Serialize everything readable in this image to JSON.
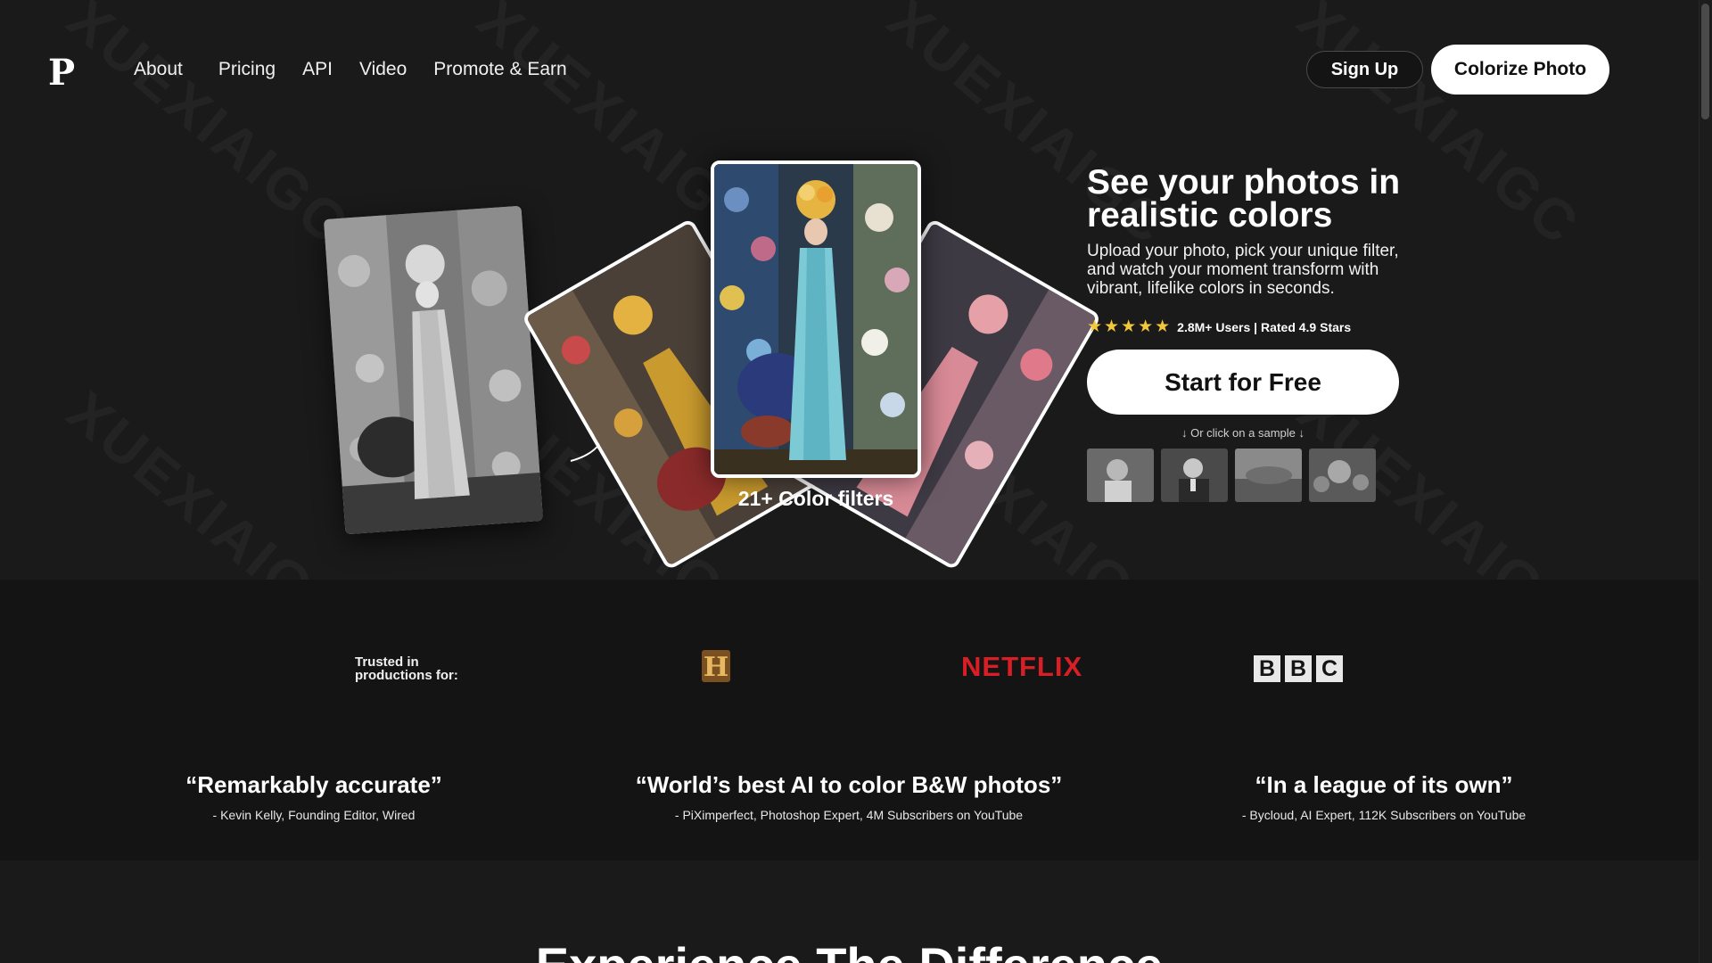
{
  "brand": {
    "logo_letter": "P"
  },
  "nav": {
    "items": [
      "About",
      "Pricing",
      "API",
      "Video",
      "Promote & Earn"
    ]
  },
  "header": {
    "signup_label": "Sign Up",
    "colorize_label": "Colorize Photo"
  },
  "hero": {
    "title": "See your photos in realistic colors",
    "description": "Upload your photo, pick your unique filter, and watch your moment transform with vibrant, lifelike colors in seconds.",
    "stars": "★★★★★",
    "rating_text": "2.8M+ Users | Rated 4.9 Stars",
    "cta_label": "Start for Free",
    "sample_hint": "↓ Or click on a sample ↓",
    "filters_label": "21+ Color filters"
  },
  "trusted": {
    "label_line1": "Trusted in",
    "label_line2": "productions for:",
    "history_letter": "H",
    "netflix": "NETFLIX",
    "bbc": [
      "B",
      "B",
      "C"
    ]
  },
  "quotes": [
    {
      "text": "“Remarkably accurate”",
      "author": "- Kevin Kelly, Founding Editor, Wired"
    },
    {
      "text": "“World’s best AI to color B&W photos”",
      "author": "- PiXimperfect, Photoshop Expert, 4M Subscribers on YouTube"
    },
    {
      "text": "“In a league of its own”",
      "author": "- Bycloud, AI Expert, 112K Subscribers on YouTube"
    }
  ],
  "section2": {
    "title": "Experience The Difference"
  },
  "watermark": "XUEXIAIGC",
  "colors": {
    "background": "#1a1a1a",
    "band": "#141414",
    "star": "#f3c73a",
    "netflix": "#d81f26"
  }
}
